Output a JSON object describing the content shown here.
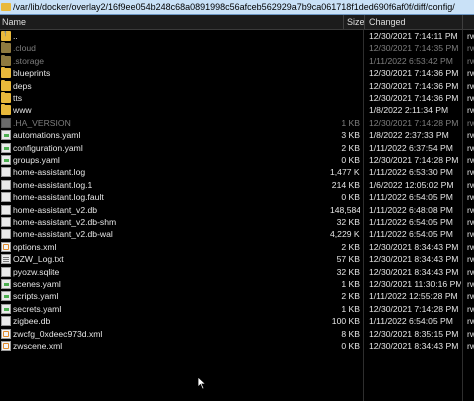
{
  "path": "/var/lib/docker/overlay2/16f9ee054b248c68a0891998c56afceb562929a7b9ca061718f1ded690f6af0f/diff/config/",
  "columns": {
    "name": "Name",
    "size": "Size",
    "changed": "Changed"
  },
  "files": [
    {
      "name": "..",
      "size": "",
      "changed": "12/30/2021 7:14:11 PM",
      "rights": "rw",
      "icon": "parent-folder-icon",
      "hidden": false
    },
    {
      "name": ".cloud",
      "size": "",
      "changed": "12/30/2021 7:14:35 PM",
      "rights": "rw",
      "icon": "folder-icon",
      "hidden": true
    },
    {
      "name": ".storage",
      "size": "",
      "changed": "1/11/2022 6:53:42 PM",
      "rights": "rw",
      "icon": "folder-icon",
      "hidden": true
    },
    {
      "name": "blueprints",
      "size": "",
      "changed": "12/30/2021 7:14:36 PM",
      "rights": "rw",
      "icon": "folder-icon",
      "hidden": false
    },
    {
      "name": "deps",
      "size": "",
      "changed": "12/30/2021 7:14:36 PM",
      "rights": "rw",
      "icon": "folder-icon",
      "hidden": false
    },
    {
      "name": "tts",
      "size": "",
      "changed": "12/30/2021 7:14:36 PM",
      "rights": "rw",
      "icon": "folder-icon",
      "hidden": false
    },
    {
      "name": "www",
      "size": "",
      "changed": "1/8/2022 2:11:34 PM",
      "rights": "rw",
      "icon": "folder-icon",
      "hidden": false
    },
    {
      "name": ".HA_VERSION",
      "size": "1 KB",
      "changed": "12/30/2021 7:14:28 PM",
      "rights": "rw",
      "icon": "file-icon",
      "hidden": true
    },
    {
      "name": "automations.yaml",
      "size": "3 KB",
      "changed": "1/8/2022 2:37:33 PM",
      "rights": "rw",
      "icon": "config-file-icon",
      "hidden": false
    },
    {
      "name": "configuration.yaml",
      "size": "2 KB",
      "changed": "1/11/2022 6:37:54 PM",
      "rights": "rw",
      "icon": "config-file-icon",
      "hidden": false
    },
    {
      "name": "groups.yaml",
      "size": "0 KB",
      "changed": "12/30/2021 7:14:28 PM",
      "rights": "rw",
      "icon": "config-file-icon",
      "hidden": false
    },
    {
      "name": "home-assistant.log",
      "size": "1,477 KB",
      "changed": "1/11/2022 6:53:30 PM",
      "rights": "rw",
      "icon": "file-icon",
      "hidden": false
    },
    {
      "name": "home-assistant.log.1",
      "size": "214 KB",
      "changed": "1/6/2022 12:05:02 PM",
      "rights": "rw",
      "icon": "file-icon",
      "hidden": false
    },
    {
      "name": "home-assistant.log.fault",
      "size": "0 KB",
      "changed": "1/11/2022 6:54:05 PM",
      "rights": "rw",
      "icon": "file-icon",
      "hidden": false
    },
    {
      "name": "home-assistant_v2.db",
      "size": "148,584 KB",
      "changed": "1/11/2022 6:48:08 PM",
      "rights": "rw",
      "icon": "file-icon",
      "hidden": false
    },
    {
      "name": "home-assistant_v2.db-shm",
      "size": "32 KB",
      "changed": "1/11/2022 6:54:05 PM",
      "rights": "rw",
      "icon": "file-icon",
      "hidden": false
    },
    {
      "name": "home-assistant_v2.db-wal",
      "size": "4,229 KB",
      "changed": "1/11/2022 6:54:05 PM",
      "rights": "rw",
      "icon": "file-icon",
      "hidden": false
    },
    {
      "name": "options.xml",
      "size": "2 KB",
      "changed": "12/30/2021 8:34:43 PM",
      "rights": "rw",
      "icon": "xml-file-icon",
      "hidden": false
    },
    {
      "name": "OZW_Log.txt",
      "size": "57 KB",
      "changed": "12/30/2021 8:34:43 PM",
      "rights": "rw",
      "icon": "text-file-icon",
      "hidden": false
    },
    {
      "name": "pyozw.sqlite",
      "size": "32 KB",
      "changed": "12/30/2021 8:34:43 PM",
      "rights": "rw",
      "icon": "file-icon",
      "hidden": false
    },
    {
      "name": "scenes.yaml",
      "size": "1 KB",
      "changed": "12/30/2021 11:30:16 PM",
      "rights": "rw",
      "icon": "config-file-icon",
      "hidden": false
    },
    {
      "name": "scripts.yaml",
      "size": "2 KB",
      "changed": "1/11/2022 12:55:28 PM",
      "rights": "rw",
      "icon": "config-file-icon",
      "hidden": false
    },
    {
      "name": "secrets.yaml",
      "size": "1 KB",
      "changed": "12/30/2021 7:14:28 PM",
      "rights": "rw",
      "icon": "config-file-icon",
      "hidden": false
    },
    {
      "name": "zigbee.db",
      "size": "100 KB",
      "changed": "1/11/2022 6:54:05 PM",
      "rights": "rw",
      "icon": "file-icon",
      "hidden": false
    },
    {
      "name": "zwcfg_0xdeec973d.xml",
      "size": "8 KB",
      "changed": "12/30/2021 8:35:15 PM",
      "rights": "rw",
      "icon": "xml-file-icon",
      "hidden": false
    },
    {
      "name": "zwscene.xml",
      "size": "0 KB",
      "changed": "12/30/2021 8:34:43 PM",
      "rights": "rw",
      "icon": "xml-file-icon",
      "hidden": false
    }
  ]
}
